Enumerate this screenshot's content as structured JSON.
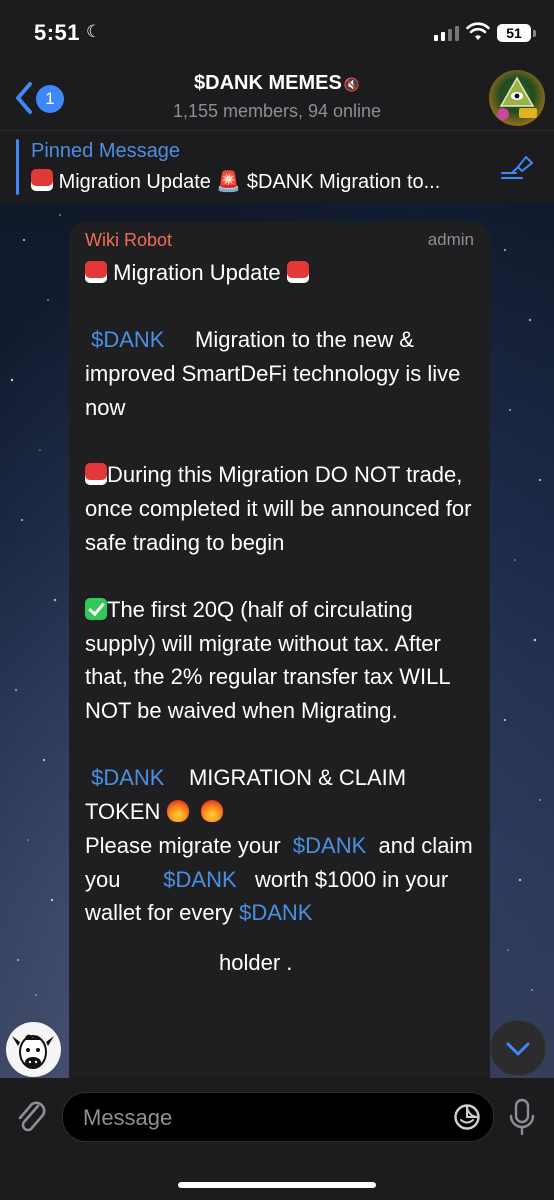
{
  "status_bar": {
    "time": "5:51",
    "battery": "51"
  },
  "header": {
    "back_badge": "1",
    "title": "$DANK MEMES",
    "subtitle": "1,155 members, 94 online"
  },
  "pinned": {
    "title": "Pinned Message",
    "text": "Migration Update 🚨 $DANK Migration to..."
  },
  "message": {
    "sender": "Wiki Robot",
    "role": "admin",
    "line1": "Migration Update",
    "p1_tag": "$DANK",
    "p1_text": "Migration to the new & improved SmartDeFi technology is live now",
    "p2_text": "During this Migration DO NOT trade, once completed it will be announced for safe trading to begin",
    "p3_text": "The first 20Q (half of circulating supply) will migrate without tax. After that, the 2% regular transfer tax WILL NOT be waived when Migrating.",
    "p4_tag": "$DANK",
    "p4_text": "MIGRATION  &  CLAIM TOKEN",
    "p5_a": "Please migrate your",
    "p5_tag1": "$DANK",
    "p5_b": "and claim you",
    "p5_tag2": "$DANK",
    "p5_c": "worth $1000  in your wallet for every",
    "p5_tag3": "$DANK",
    "p6_text": "holder ."
  },
  "input": {
    "placeholder": "Message"
  }
}
